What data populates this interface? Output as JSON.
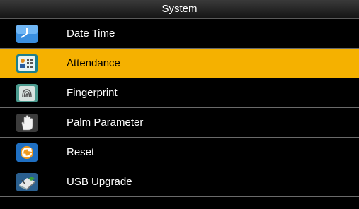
{
  "title": "System",
  "selected_index": 1,
  "menu": [
    {
      "label": "Date Time",
      "icon": "clock-icon"
    },
    {
      "label": "Attendance",
      "icon": "attendance-icon"
    },
    {
      "label": "Fingerprint",
      "icon": "fingerprint-icon"
    },
    {
      "label": "Palm Parameter",
      "icon": "palm-icon"
    },
    {
      "label": "Reset",
      "icon": "reset-icon"
    },
    {
      "label": "USB Upgrade",
      "icon": "usb-icon"
    }
  ],
  "colors": {
    "highlight": "#f5b100",
    "background": "#000000",
    "separator": "#6a6a6a"
  }
}
